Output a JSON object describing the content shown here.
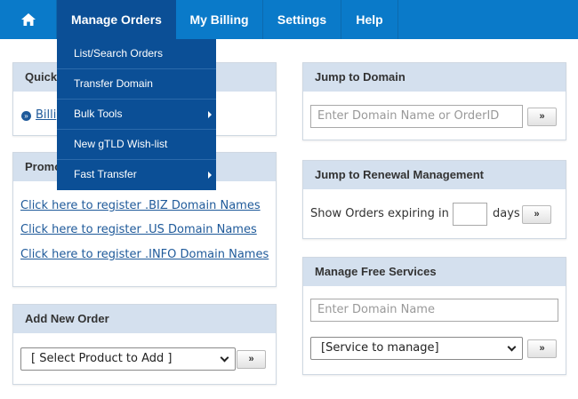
{
  "nav": {
    "home_icon": "home-icon",
    "manage_orders": "Manage Orders",
    "my_billing": "My Billing",
    "settings": "Settings",
    "help": "Help"
  },
  "dropdown": {
    "items": [
      {
        "label": "List/Search Orders",
        "submenu": false
      },
      {
        "label": "Transfer Domain",
        "submenu": false
      },
      {
        "label": "Bulk Tools",
        "submenu": true
      },
      {
        "label": "New gTLD Wish-list",
        "submenu": false
      },
      {
        "label": "Fast Transfer",
        "submenu": true
      }
    ]
  },
  "quick": {
    "title": "Quick",
    "link": "Billi"
  },
  "promo": {
    "title": "Promo",
    "links": [
      "Click here to register .BIZ Domain Names",
      "Click here to register .US Domain Names",
      "Click here to register .INFO Domain Names"
    ]
  },
  "add_order": {
    "title": "Add New Order",
    "select_value": "[ Select Product to Add ]",
    "go_label": "»"
  },
  "jump_domain": {
    "title": "Jump to Domain",
    "placeholder": "Enter Domain Name or OrderID",
    "go_label": "»"
  },
  "renewal": {
    "title": "Jump to Renewal Management",
    "prefix": "Show Orders expiring in",
    "suffix": "days",
    "go_label": "»"
  },
  "free_services": {
    "title": "Manage Free Services",
    "placeholder": "Enter Domain Name",
    "select_value": "[Service to manage]",
    "go_label": "»"
  },
  "colors": {
    "nav_bg": "#0a7ac9",
    "nav_active": "#0b4f96",
    "panel_head": "#d4e0ee",
    "link": "#1f5a9a"
  }
}
